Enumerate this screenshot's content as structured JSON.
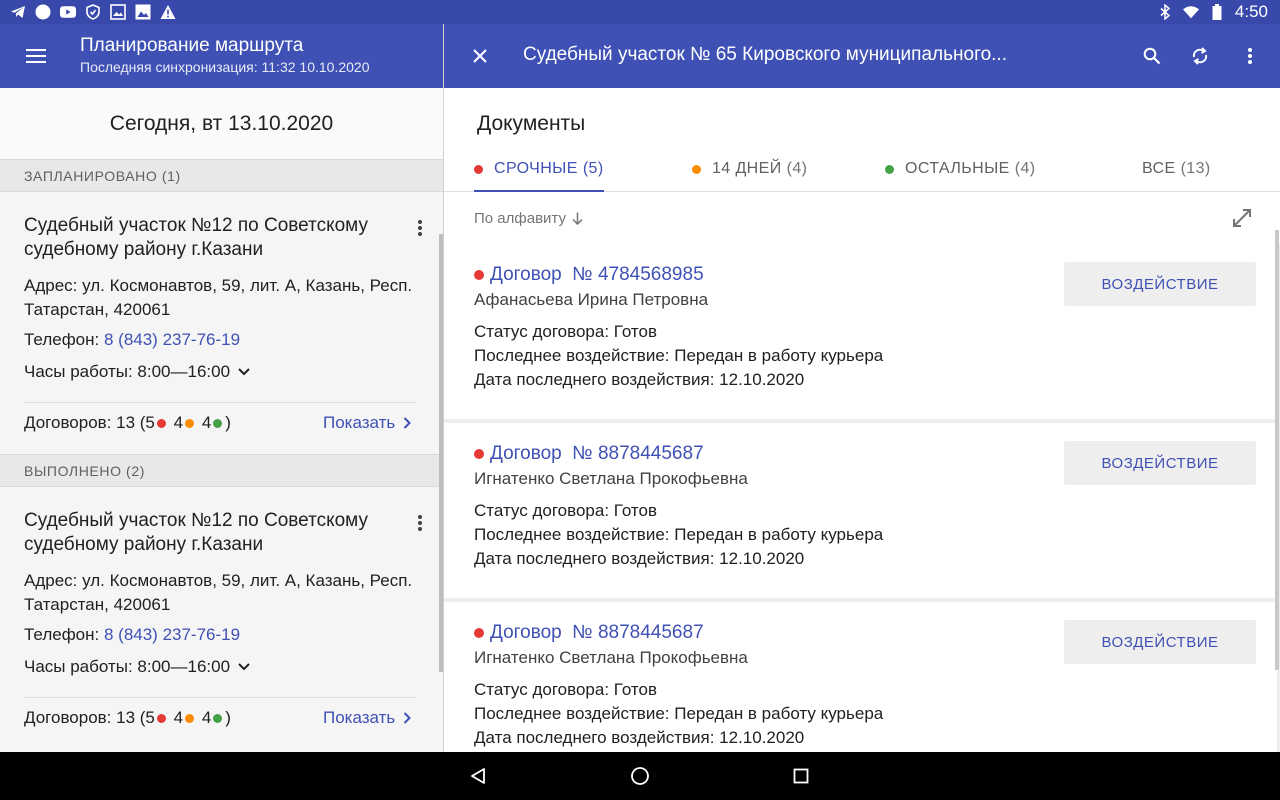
{
  "status_bar": {
    "time": "4:50",
    "left_icons": [
      "telegram-icon",
      "circle-icon",
      "youtube-icon",
      "vpn-shield-icon",
      "image-icon",
      "photo-icon",
      "warning-icon"
    ],
    "right_icons": [
      "bluetooth-icon",
      "wifi-icon",
      "battery-icon"
    ]
  },
  "left_toolbar": {
    "title": "Планирование маршрута",
    "subtitle": "Последняя синхронизация: 11:32 10.10.2020"
  },
  "right_toolbar": {
    "title": "Судебный участок № 65 Кировского муниципального..."
  },
  "left_pane": {
    "date": "Сегодня, вт 13.10.2020",
    "sections": [
      {
        "header": "ЗАПЛАНИРОВАНО (1)",
        "card": {
          "title": "Судебный участок №12 по Советскому судебному району г.Казани",
          "address_label": "Адрес:",
          "address": "ул. Космонавтов, 59, лит. А, Казань, Респ. Татарстан, 420061",
          "phone_label": "Телефон:",
          "phone": "8 (843) 237-76-19",
          "hours_label": "Часы работы:",
          "hours": "8:00—16:00",
          "contracts_label": "Договоров: 13 (",
          "count_red": "5",
          "count_orange": "4",
          "count_green": "4",
          "contracts_close": ")",
          "show_label": "Показать"
        }
      },
      {
        "header": "ВЫПОЛНЕНО (2)",
        "card": {
          "title": "Судебный участок №12 по Советскому судебному району г.Казани",
          "address_label": "Адрес:",
          "address": "ул. Космонавтов, 59, лит. А, Казань, Респ. Татарстан, 420061",
          "phone_label": "Телефон:",
          "phone": "8 (843) 237-76-19",
          "hours_label": "Часы работы:",
          "hours": "8:00—16:00",
          "contracts_label": "Договоров: 13 (",
          "count_red": "5",
          "count_orange": "4",
          "count_green": "4",
          "contracts_close": ")",
          "show_label": "Показать"
        }
      }
    ]
  },
  "right_pane": {
    "title": "Документы",
    "tabs": [
      {
        "label": "СРОЧНЫЕ",
        "count": "(5)",
        "dot_color": "#e53935",
        "active": true
      },
      {
        "label": "14 ДНЕЙ",
        "count": "(4)",
        "dot_color": "#fb8c00",
        "active": false
      },
      {
        "label": "ОСТАЛЬНЫЕ",
        "count": "(4)",
        "dot_color": "#43a047",
        "active": false
      },
      {
        "label": "ВСЕ",
        "count": "(13)",
        "dot_color": null,
        "active": false
      }
    ],
    "sort_label": "По алфавиту",
    "documents": [
      {
        "title": "Договор  № 4784568985",
        "person": "Афанасьева Ирина Петровна",
        "status_label": "Статус договора:",
        "status": "Готов",
        "last_action_label": "Последнее воздействие:",
        "last_action": "Передан в работу курьера",
        "last_date_label": "Дата последнего воздействия:",
        "last_date": "12.10.2020",
        "button": "ВОЗДЕЙСТВИЕ"
      },
      {
        "title": "Договор  № 8878445687",
        "person": "Игнатенко Светлана Прокофьевна",
        "status_label": "Статус договора:",
        "status": "Готов",
        "last_action_label": "Последнее воздействие:",
        "last_action": "Передан в работу курьера",
        "last_date_label": "Дата последнего воздействия:",
        "last_date": "12.10.2020",
        "button": "ВОЗДЕЙСТВИЕ"
      },
      {
        "title": "Договор  № 8878445687",
        "person": "Игнатенко Светлана Прокофьевна",
        "status_label": "Статус договора:",
        "status": "Готов",
        "last_action_label": "Последнее воздействие:",
        "last_action": "Передан в работу курьера",
        "last_date_label": "Дата последнего воздействия:",
        "last_date": "12.10.2020",
        "button": "ВОЗДЕЙСТВИЕ"
      }
    ]
  },
  "colors": {
    "primary": "#3f51b5",
    "status_bar": "#3949ab",
    "dot_red": "#e53935",
    "dot_orange": "#fb8c00",
    "dot_green": "#43a047"
  },
  "nav_icons": [
    "back-icon",
    "home-icon",
    "recents-icon"
  ]
}
